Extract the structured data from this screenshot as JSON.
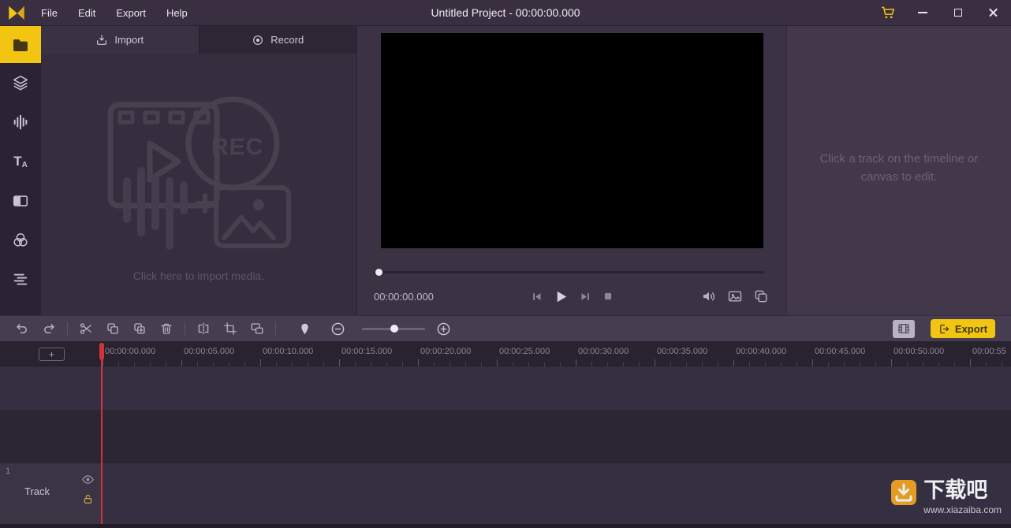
{
  "colors": {
    "accent": "#f3c513",
    "playhead": "#d03436",
    "titlebar_bg": "#3a2f41",
    "timeline_bg": "#2d2735"
  },
  "titlebar": {
    "title": "Untitled Project - 00:00:00.000",
    "menus": [
      {
        "label": "File"
      },
      {
        "label": "Edit"
      },
      {
        "label": "Export"
      },
      {
        "label": "Help"
      }
    ]
  },
  "sidebar": {
    "text_tool": {
      "primary": "T",
      "secondary": "A"
    },
    "items": [
      {
        "name": "media",
        "icon": "folder-icon",
        "active": true
      },
      {
        "name": "elements",
        "icon": "layers-icon",
        "active": false
      },
      {
        "name": "audio",
        "icon": "audio-waveform-icon",
        "active": false
      },
      {
        "name": "text",
        "icon": "text-icon",
        "active": false
      },
      {
        "name": "transitions",
        "icon": "transitions-icon",
        "active": false
      },
      {
        "name": "filters",
        "icon": "filters-icon",
        "active": false
      },
      {
        "name": "behaviors",
        "icon": "behaviors-icon",
        "active": false
      }
    ]
  },
  "media": {
    "tabs": [
      {
        "label": "Import"
      },
      {
        "label": "Record"
      }
    ],
    "rec": "REC",
    "placeholder": "Click here to import media."
  },
  "preview": {
    "time": "00:00:00.000"
  },
  "properties": {
    "hint": "Click a track on the timeline or canvas to edit."
  },
  "toolbar": {
    "export": "Export"
  },
  "timeline": {
    "add_label": "+",
    "ruler_labels": [
      "00:00:00.000",
      "00:00:05.000",
      "00:00:10.000",
      "00:00:15.000",
      "00:00:20.000",
      "00:00:25.000",
      "00:00:30.000",
      "00:00:35.000",
      "00:00:40.000",
      "00:00:45.000",
      "00:00:50.000",
      "00:00:55"
    ],
    "track": {
      "index": "1",
      "name": "Track"
    }
  },
  "watermark": {
    "brand": "下载吧",
    "site": "www.xiazaiba.com"
  }
}
